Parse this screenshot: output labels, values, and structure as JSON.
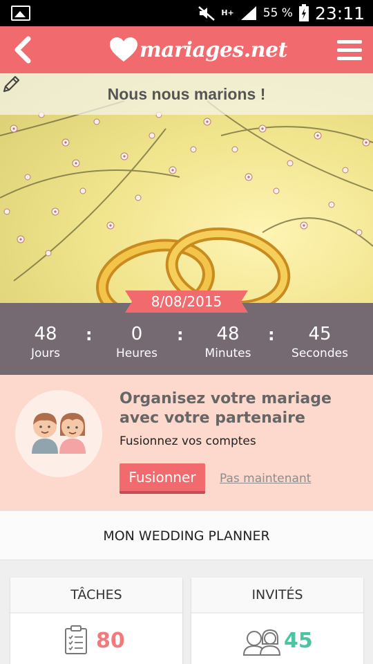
{
  "status_bar": {
    "network": "H+",
    "battery": "55 %",
    "time": "23:11"
  },
  "app_bar": {
    "logo_text": "mariages.net"
  },
  "hero": {
    "title": "Nous nous marions !"
  },
  "countdown": {
    "date": "8/08/2015",
    "units": [
      {
        "value": "48",
        "label": "Jours"
      },
      {
        "value": "0",
        "label": "Heures"
      },
      {
        "value": "48",
        "label": "Minutes"
      },
      {
        "value": "45",
        "label": "Secondes"
      }
    ],
    "separator": ":"
  },
  "promo": {
    "title": "Organisez votre mariage avec votre partenaire",
    "subtitle": "Fusionnez vos comptes",
    "primary_button": "Fusionner",
    "secondary_link": "Pas maintenant"
  },
  "planner": {
    "title": "MON WEDDING PLANNER"
  },
  "cards": [
    {
      "title": "TÂCHES",
      "value": "80",
      "icon": "clipboard-icon",
      "color": "#f07a7c"
    },
    {
      "title": "INVITÉS",
      "value": "45",
      "icon": "guests-icon",
      "color": "#4cc4a4"
    }
  ],
  "colors": {
    "accent": "#f06a6e",
    "countdown_bg": "#756a71",
    "promo_bg": "#fdd9cd"
  }
}
